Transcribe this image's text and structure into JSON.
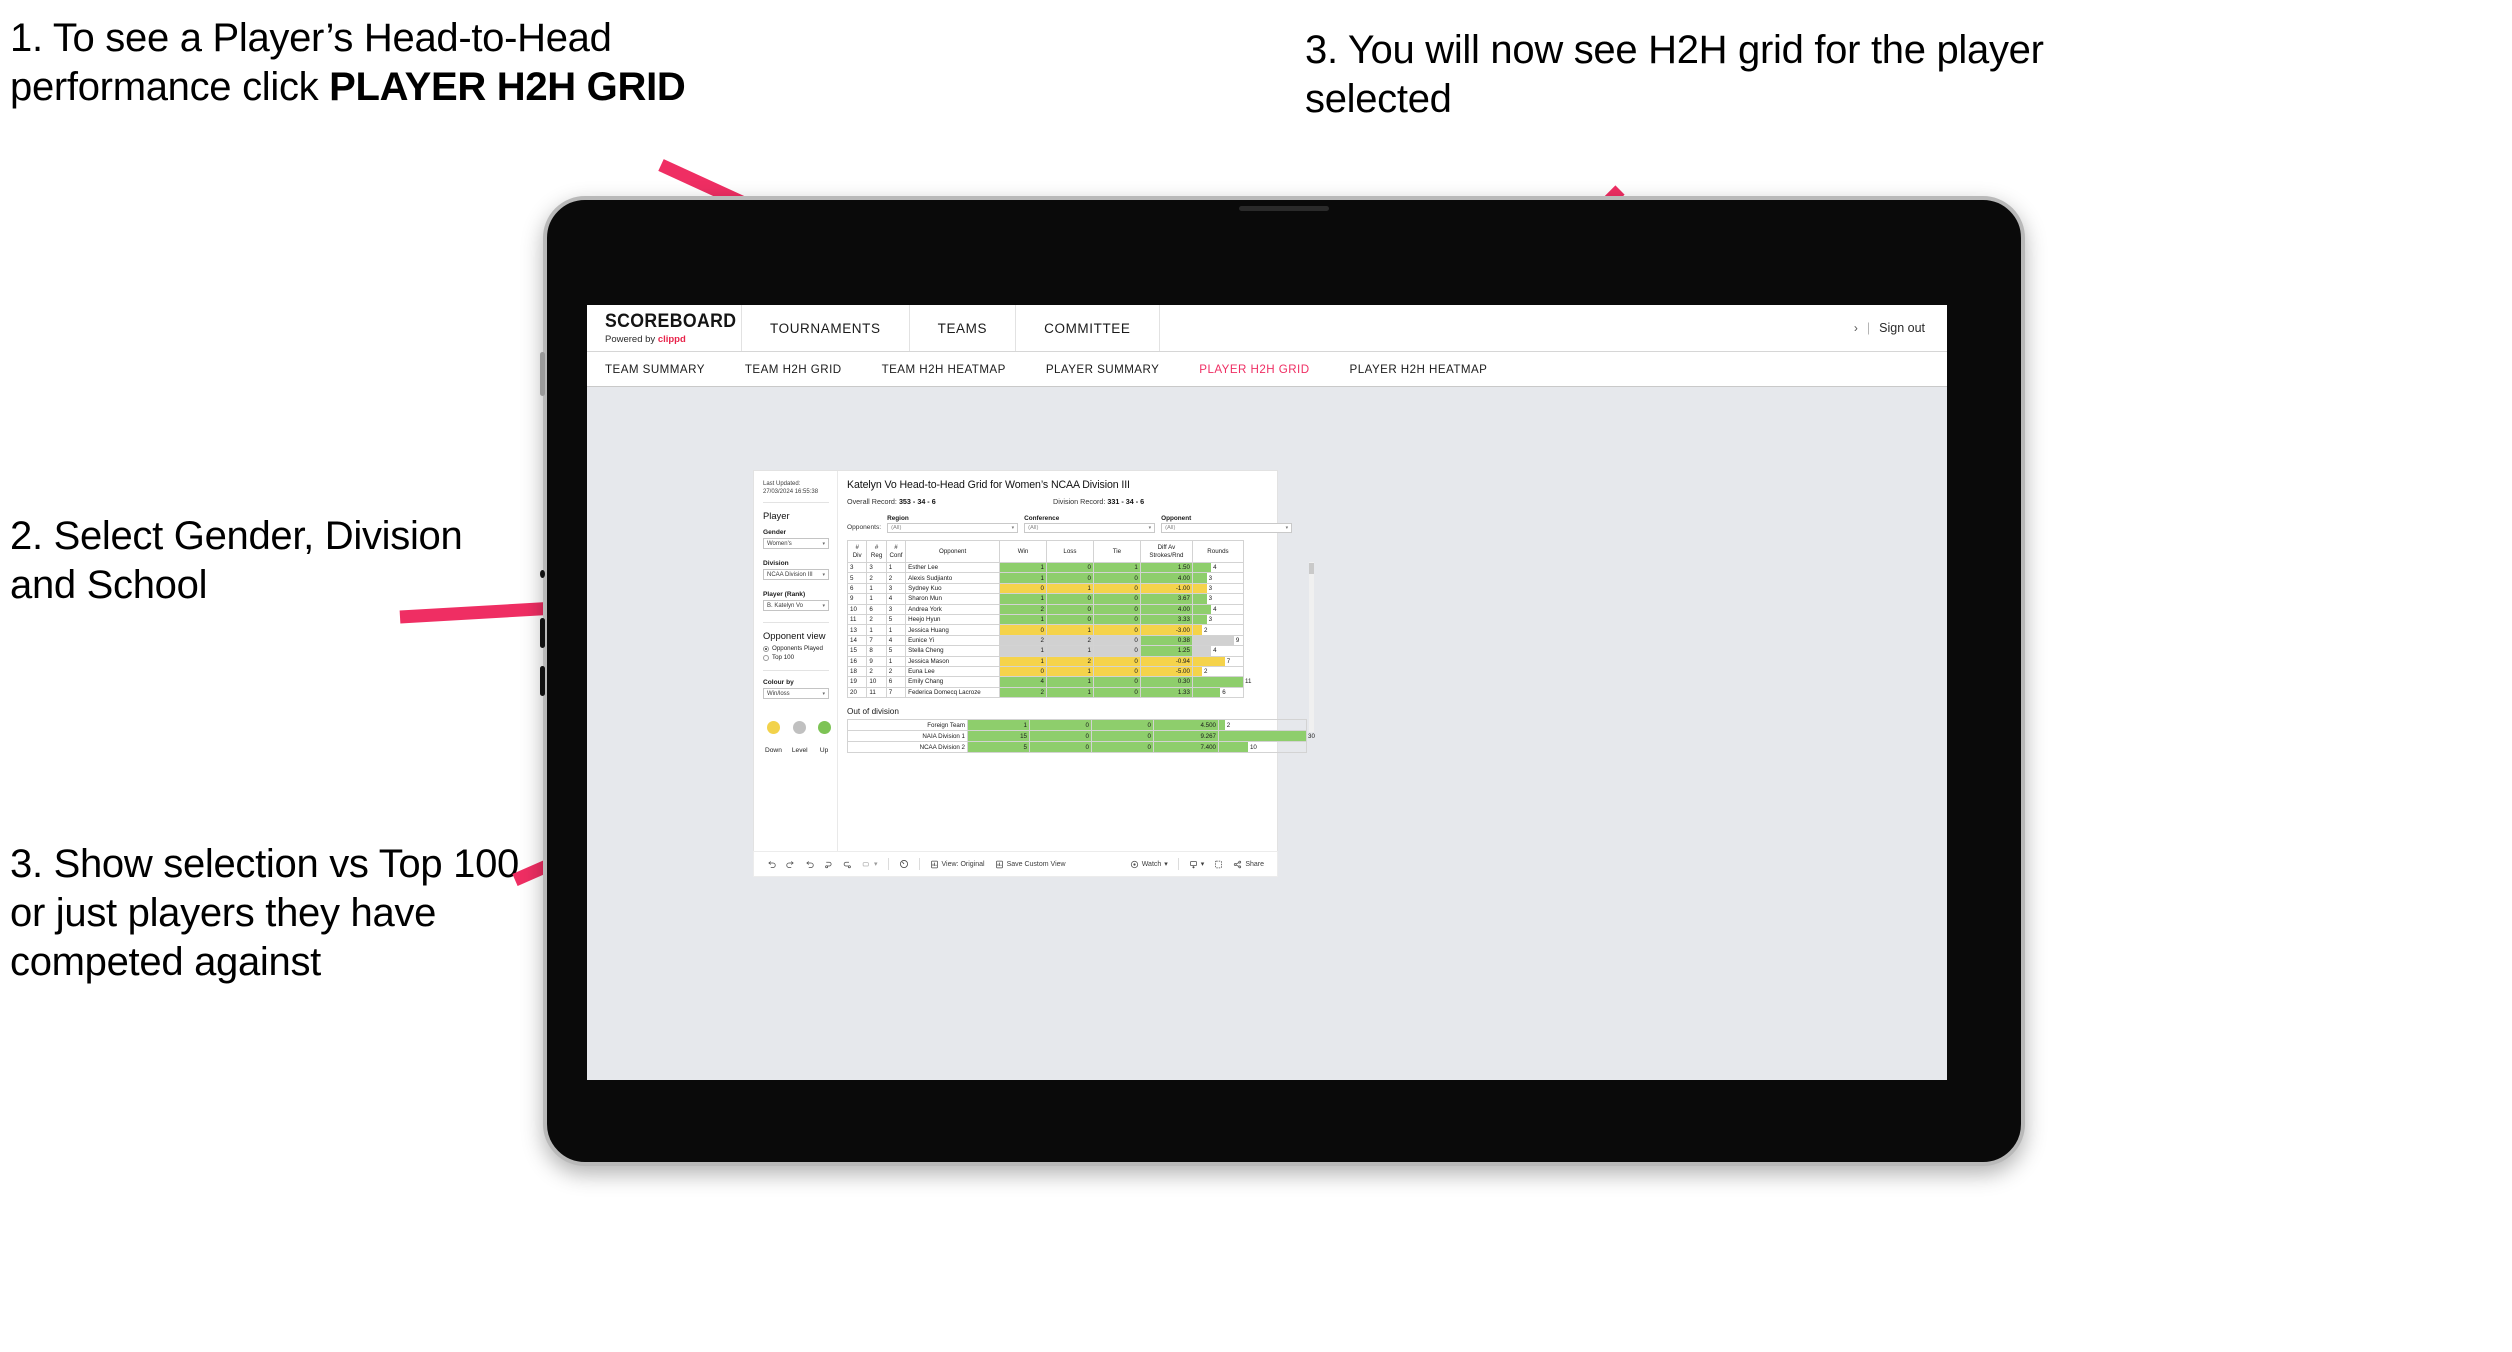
{
  "annotations": {
    "step1_a": "1. To see a Player’s Head-to-Head performance click ",
    "step1_b": "PLAYER H2H GRID",
    "step2": "2. Select Gender, Division and School",
    "step3": "3. Show selection vs Top 100 or just players they have competed against",
    "step4": "3. You will now see H2H grid for the player selected",
    "arrow_color": "#ef2e63"
  },
  "app": {
    "logo_main": "SCOREBOARD",
    "logo_sub_prefix": "Powered by ",
    "logo_sub_brand": "clippd",
    "top_nav": [
      "TOURNAMENTS",
      "TEAMS",
      "COMMITTEE"
    ],
    "account_chevron": "›",
    "account_sep": "|",
    "sign_out": "Sign out",
    "sub_nav": [
      {
        "label": "TEAM SUMMARY",
        "active": false
      },
      {
        "label": "TEAM H2H GRID",
        "active": false
      },
      {
        "label": "TEAM H2H HEATMAP",
        "active": false
      },
      {
        "label": "PLAYER SUMMARY",
        "active": false
      },
      {
        "label": "PLAYER H2H GRID",
        "active": true
      },
      {
        "label": "PLAYER H2H HEATMAP",
        "active": false
      }
    ],
    "active_tab_color": "#ef2e63"
  },
  "sidebar": {
    "last_updated": "Last Updated: 27/03/2024 16:55:38",
    "player_heading": "Player",
    "filters": [
      {
        "label": "Gender",
        "value": "Women's"
      },
      {
        "label": "Division",
        "value": "NCAA Division III"
      },
      {
        "label": "Player (Rank)",
        "value": "B. Katelyn Vo"
      }
    ],
    "opponent_view_heading": "Opponent view",
    "opponent_view_options": [
      {
        "label": "Opponents Played",
        "selected": true
      },
      {
        "label": "Top 100",
        "selected": false
      }
    ],
    "colour_by_label": "Colour by",
    "colour_by_value": "Win/loss",
    "legend": [
      {
        "label": "Down",
        "color": "#f2d24b"
      },
      {
        "label": "Level",
        "color": "#c0c0c0"
      },
      {
        "label": "Up",
        "color": "#7dc355"
      }
    ]
  },
  "main": {
    "title": "Katelyn Vo Head-to-Head Grid for Women’s NCAA Division III",
    "overall_record_label": "Overall Record: ",
    "overall_record_value": "353 -  34 - 6",
    "division_record_label": "Division Record: ",
    "division_record_value": "331 -  34 - 6",
    "opponents_label": "Opponents:",
    "opponent_filters": [
      {
        "label": "Region",
        "value": "(All)"
      },
      {
        "label": "Conference",
        "value": "(All)"
      },
      {
        "label": "Opponent",
        "value": "(All)"
      }
    ],
    "out_of_division_heading": "Out of division"
  },
  "chart_data": {
    "type": "table",
    "title": "Katelyn Vo Head-to-Head Grid for Women’s NCAA Division III",
    "columns": [
      "# Div",
      "# Reg",
      "# Conf",
      "Opponent",
      "Win",
      "Loss",
      "Tie",
      "Diff Av Strokes/Rnd",
      "Rounds"
    ],
    "column_header_lines": [
      [
        "#",
        "Div"
      ],
      [
        "#",
        "Reg"
      ],
      [
        "#",
        "Conf"
      ],
      [
        "Opponent"
      ],
      [
        "Win"
      ],
      [
        "Loss"
      ],
      [
        "Tie"
      ],
      [
        "Diff Av",
        "Strokes/Rnd"
      ],
      [
        "Rounds"
      ]
    ],
    "rounds_max": 11,
    "rows": [
      {
        "div": "3",
        "reg": "3",
        "conf": "1",
        "opponent": "Esther Lee",
        "win": "1",
        "loss": "0",
        "tie": "1",
        "diff": "1.50",
        "rounds": "4",
        "color": "#8ece6c"
      },
      {
        "div": "5",
        "reg": "2",
        "conf": "2",
        "opponent": "Alexis Sudjianto",
        "win": "1",
        "loss": "0",
        "tie": "0",
        "diff": "4.00",
        "rounds": "3",
        "color": "#8ece6c"
      },
      {
        "div": "6",
        "reg": "1",
        "conf": "3",
        "opponent": "Sydney Kuo",
        "win": "0",
        "loss": "1",
        "tie": "0",
        "diff": "-1.00",
        "rounds": "3",
        "color": "#f5d34b"
      },
      {
        "div": "9",
        "reg": "1",
        "conf": "4",
        "opponent": "Sharon Mun",
        "win": "1",
        "loss": "0",
        "tie": "0",
        "diff": "3.67",
        "rounds": "3",
        "color": "#8ece6c"
      },
      {
        "div": "10",
        "reg": "6",
        "conf": "3",
        "opponent": "Andrea York",
        "win": "2",
        "loss": "0",
        "tie": "0",
        "diff": "4.00",
        "rounds": "4",
        "color": "#8ece6c"
      },
      {
        "div": "11",
        "reg": "2",
        "conf": "5",
        "opponent": "Heejo Hyun",
        "win": "1",
        "loss": "0",
        "tie": "0",
        "diff": "3.33",
        "rounds": "3",
        "color": "#8ece6c"
      },
      {
        "div": "13",
        "reg": "1",
        "conf": "1",
        "opponent": "Jessica Huang",
        "win": "0",
        "loss": "1",
        "tie": "0",
        "diff": "-3.00",
        "rounds": "2",
        "color": "#f5d34b"
      },
      {
        "div": "14",
        "reg": "7",
        "conf": "4",
        "opponent": "Eunice Yi",
        "win": "2",
        "loss": "2",
        "tie": "0",
        "diff": "0.38",
        "rounds": "9",
        "color": "#d1d1d1",
        "diff_color": "#8ece6c"
      },
      {
        "div": "15",
        "reg": "8",
        "conf": "5",
        "opponent": "Stella Cheng",
        "win": "1",
        "loss": "1",
        "tie": "0",
        "diff": "1.25",
        "rounds": "4",
        "color": "#d1d1d1",
        "diff_color": "#8ece6c"
      },
      {
        "div": "16",
        "reg": "9",
        "conf": "1",
        "opponent": "Jessica Mason",
        "win": "1",
        "loss": "2",
        "tie": "0",
        "diff": "-0.94",
        "rounds": "7",
        "color": "#f5d34b"
      },
      {
        "div": "18",
        "reg": "2",
        "conf": "2",
        "opponent": "Euna Lee",
        "win": "0",
        "loss": "1",
        "tie": "0",
        "diff": "-5.00",
        "rounds": "2",
        "color": "#f5d34b"
      },
      {
        "div": "19",
        "reg": "10",
        "conf": "6",
        "opponent": "Emily Chang",
        "win": "4",
        "loss": "1",
        "tie": "0",
        "diff": "0.30",
        "rounds": "11",
        "color": "#8ece6c"
      },
      {
        "div": "20",
        "reg": "11",
        "conf": "7",
        "opponent": "Federica Domecq Lacroze",
        "win": "2",
        "loss": "1",
        "tie": "0",
        "diff": "1.33",
        "rounds": "6",
        "color": "#8ece6c"
      }
    ],
    "out_of_division": {
      "rounds_max": 30,
      "rows": [
        {
          "name": "Foreign Team",
          "win": "1",
          "loss": "0",
          "tie": "0",
          "diff": "4.500",
          "rounds": "2",
          "color": "#8ece6c"
        },
        {
          "name": "NAIA Division 1",
          "win": "15",
          "loss": "0",
          "tie": "0",
          "diff": "9.267",
          "rounds": "30",
          "color": "#8ece6c"
        },
        {
          "name": "NCAA Division 2",
          "win": "5",
          "loss": "0",
          "tie": "0",
          "diff": "7.400",
          "rounds": "10",
          "color": "#8ece6c"
        }
      ]
    }
  },
  "toolbar": {
    "view_label": "View: Original",
    "save_label": "Save Custom View",
    "watch_label": "Watch",
    "share_label": "Share",
    "caret": "▾"
  }
}
